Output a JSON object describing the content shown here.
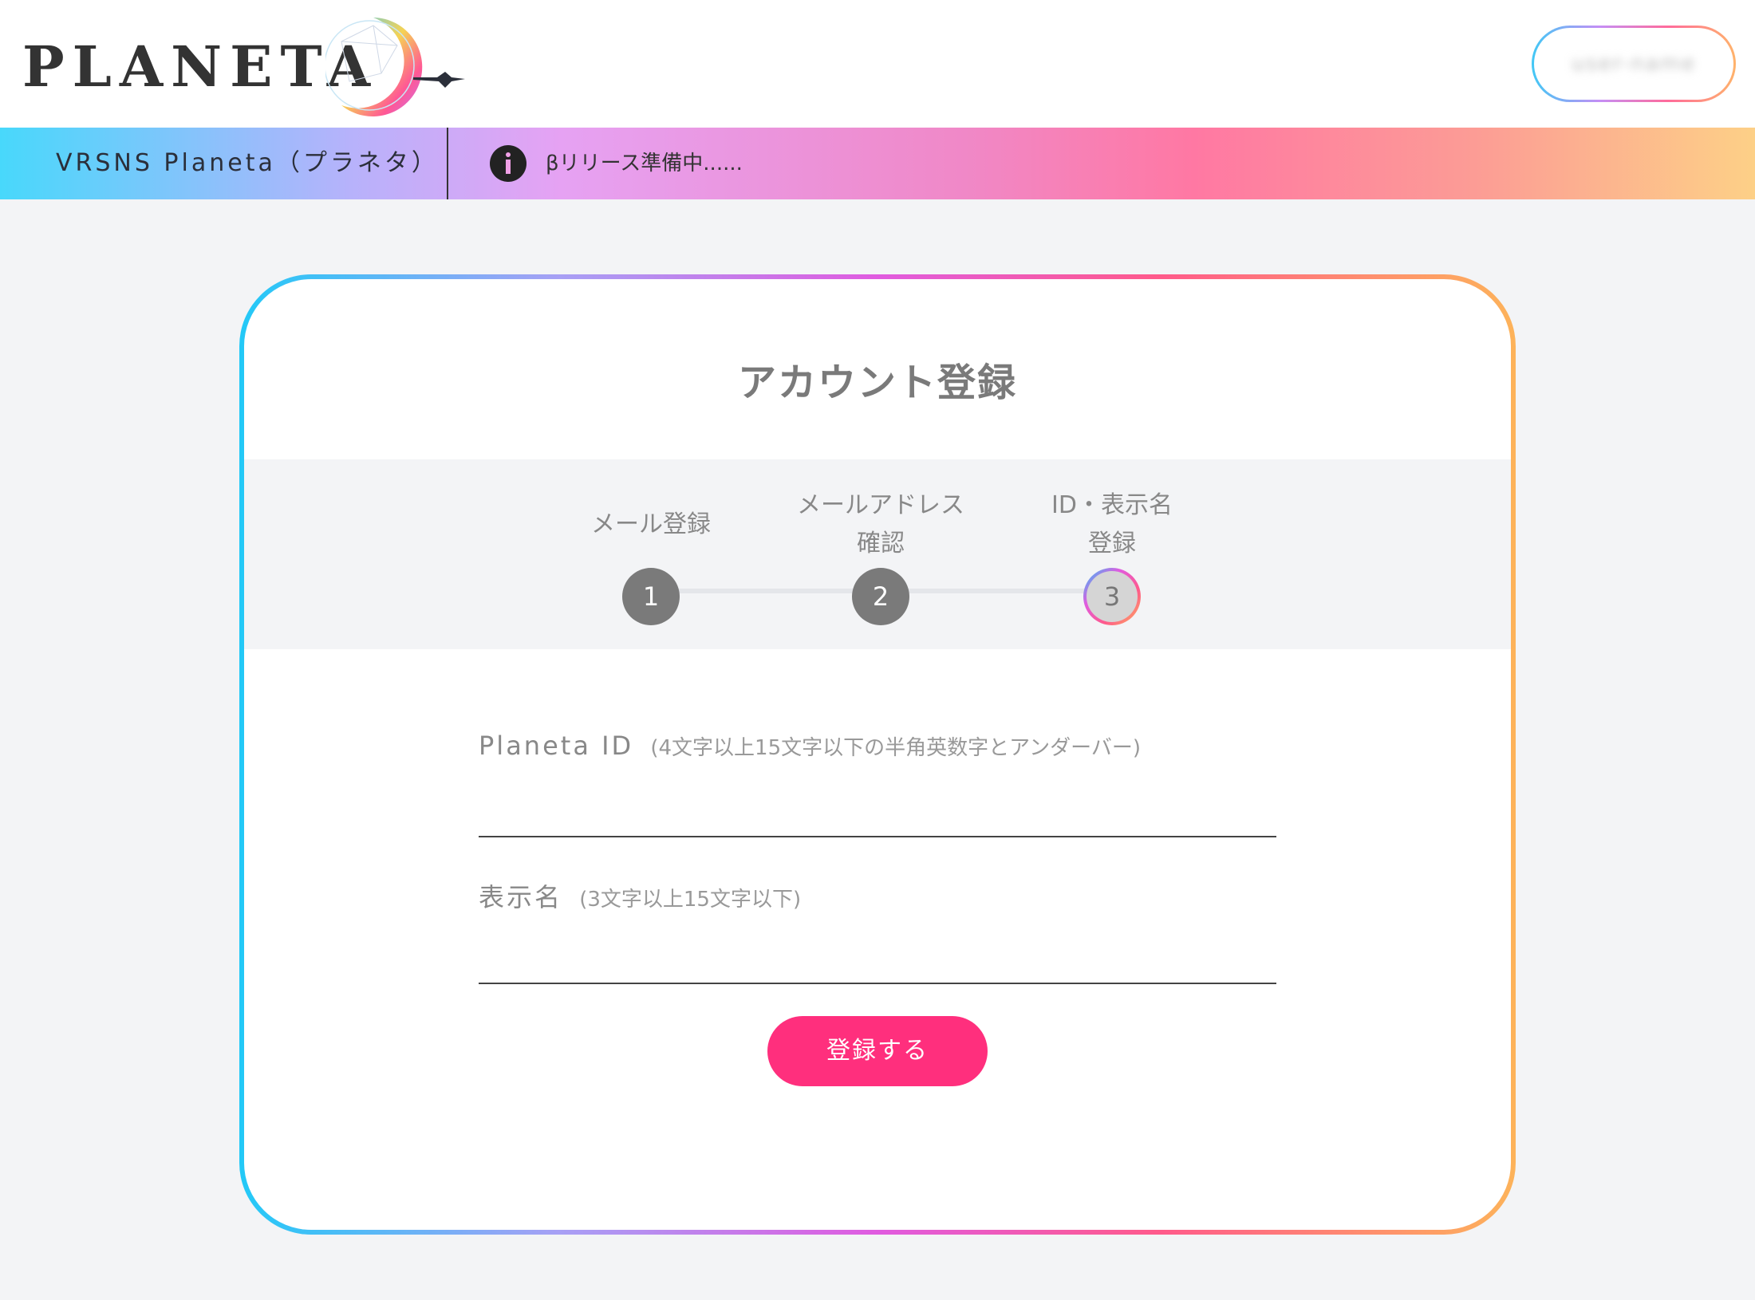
{
  "header": {
    "logo_text": "PLANETA",
    "user_name": "user-name"
  },
  "banner": {
    "title": "VRSNS Planeta（プラネタ）",
    "notice": "βリリース準備中......"
  },
  "card": {
    "title": "アカウント登録",
    "steps": [
      {
        "label": "メール登録",
        "number": "1",
        "state": "done"
      },
      {
        "label": "メールアドレス\n確認",
        "number": "2",
        "state": "done"
      },
      {
        "label": "ID・表示名\n登録",
        "number": "3",
        "state": "current"
      }
    ],
    "fields": {
      "planeta_id": {
        "label": "Planeta ID",
        "hint": "(4文字以上15文字以下の半角英数字とアンダーバー)",
        "value": ""
      },
      "display_name": {
        "label": "表示名",
        "hint": "(3文字以上15文字以下)",
        "value": ""
      }
    },
    "submit_label": "登録する"
  },
  "colors": {
    "accent": "#ff2f7d",
    "step_done": "#7a7a7a",
    "gradient": [
      "#22c9f7",
      "#a7a0f5",
      "#e05be0",
      "#ff5a8b",
      "#fdb35a"
    ]
  },
  "icons": [
    "planeta-logo-icon",
    "info-icon"
  ]
}
